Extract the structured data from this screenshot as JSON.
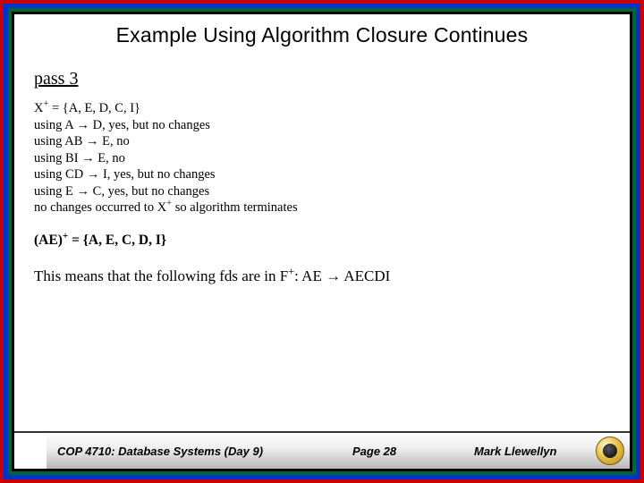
{
  "title": "Example Using Algorithm Closure Continues",
  "pass_label": "pass 3",
  "work": {
    "line1_pre": "X",
    "line1_post": " = {A, E, D, C, I}",
    "line2": "using A → D, yes, but no changes",
    "line3": "using AB → E, no",
    "line4": "using BI → E, no",
    "line5": "using CD → I, yes, but no changes",
    "line6": "using E → C, yes, but no changes",
    "line7_pre": "no changes occurred to X",
    "line7_post": " so algorithm terminates"
  },
  "result": {
    "pre": "(AE)",
    "post": " = {A, E, C, D, I}"
  },
  "meaning": {
    "pre": "This means that the following fds are in F",
    "post": ":  AE → AECDI"
  },
  "footer": {
    "course": "COP 4710: Database Systems (Day 9)",
    "page": "Page 28",
    "author": "Mark Llewellyn"
  },
  "sup_plus": "+"
}
